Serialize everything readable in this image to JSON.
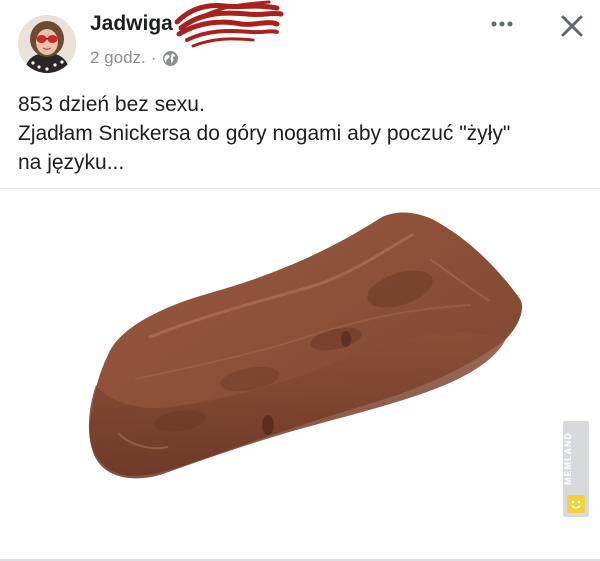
{
  "post": {
    "author_name": "Jadwiga",
    "timestamp": "2 godz.",
    "separator": "·",
    "privacy_icon": "globe-icon",
    "more_icon": "more-options-icon",
    "close_icon": "close-icon",
    "text_lines": [
      "853 dzień bez sexu.",
      "Zjadłam Snickersa do góry nogami aby poczuć \"żyły\"",
      "na języku..."
    ]
  },
  "media": {
    "image": "upside-down chocolate bar photo",
    "watermark": "MEMLAND"
  },
  "colors": {
    "text_primary": "#1c1e21",
    "text_secondary": "#8a8d91",
    "chocolate": "#8a4f36",
    "redaction": "#a8211b"
  }
}
